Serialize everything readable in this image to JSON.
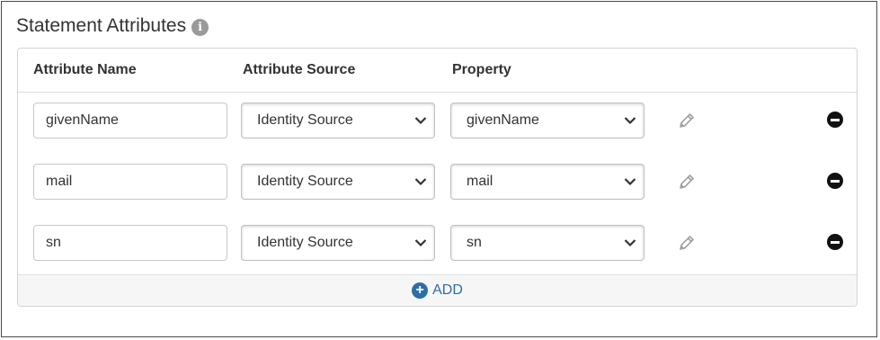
{
  "section": {
    "title": "Statement Attributes",
    "info_icon": "i"
  },
  "columns": {
    "name": "Attribute Name",
    "source": "Attribute Source",
    "property": "Property"
  },
  "rows": [
    {
      "attribute_name": "givenName",
      "attribute_source": "Identity Source",
      "property": "givenName"
    },
    {
      "attribute_name": "mail",
      "attribute_source": "Identity Source",
      "property": "mail"
    },
    {
      "attribute_name": "sn",
      "attribute_source": "Identity Source",
      "property": "sn"
    }
  ],
  "add_button": {
    "label": "ADD"
  },
  "colors": {
    "accent": "#2d6ea8",
    "remove_icon": "#111111",
    "pencil_icon": "#a0a0a0"
  }
}
